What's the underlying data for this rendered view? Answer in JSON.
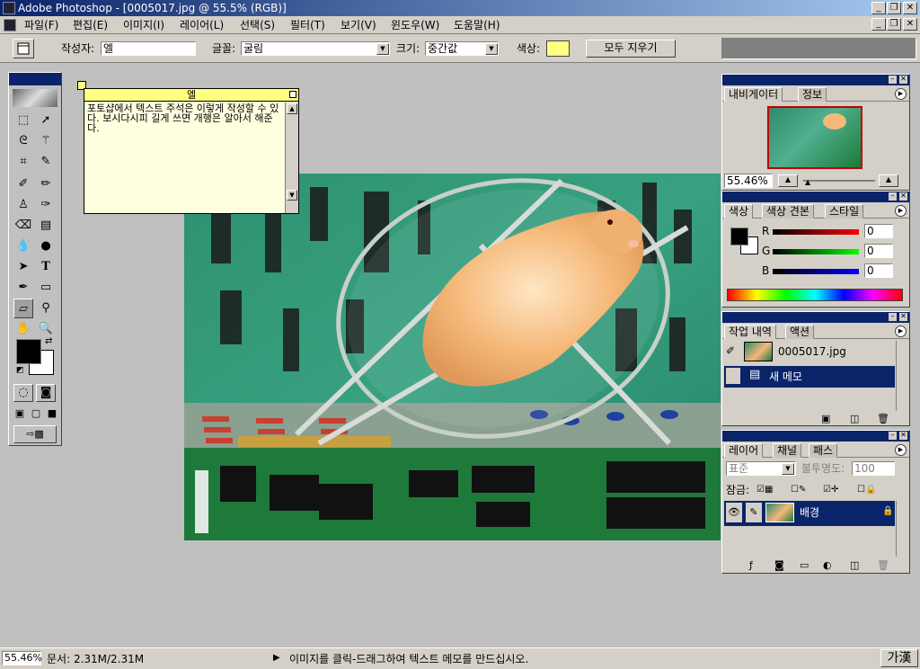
{
  "app": {
    "title": "Adobe Photoshop - [0005017.jpg @ 55.5% (RGB)]"
  },
  "menu": [
    "파일(F)",
    "편집(E)",
    "이미지(I)",
    "레이어(L)",
    "선택(S)",
    "필터(T)",
    "보기(V)",
    "윈도우(W)",
    "도움말(H)"
  ],
  "options": {
    "author_label": "작성자:",
    "author_value": "엘",
    "font_label": "글꼴:",
    "font_value": "굴림",
    "size_label": "크기:",
    "size_value": "중간값",
    "color_label": "색상:",
    "note_color": "#ffff80",
    "clear_all": "모두 지우기"
  },
  "note": {
    "title": "엘",
    "text": "포토샵에서 텍스트 주석은 이렇게 작성할 수 있다. 보시다시피 길게 쓰면 개행은 알아서 해준다."
  },
  "navigator": {
    "tabs": [
      "내비게이터",
      "정보"
    ],
    "zoom": "55.46%"
  },
  "color_panel": {
    "tabs": [
      "색상",
      "색상 견본",
      "스타일"
    ],
    "r_label": "R",
    "g_label": "G",
    "b_label": "B",
    "r": "0",
    "g": "0",
    "b": "0",
    "foreground": "#000000",
    "background": "#ffffff"
  },
  "history": {
    "tabs": [
      "작업 내역",
      "액션"
    ],
    "items": [
      "0005017.jpg",
      "새 메모"
    ]
  },
  "layers": {
    "tabs": [
      "레이어",
      "채널",
      "패스"
    ],
    "blend_mode": "표준",
    "opacity_label": "불투명도:",
    "opacity": "100",
    "lock_label": "잠금:",
    "layer_name": "배경"
  },
  "status": {
    "zoom": "55.46%",
    "doc": "문서: 2.31M/2.31M",
    "hint": "이미지를 클릭-드래그하여 텍스트 메모를 만드십시오.",
    "ime": "가漢"
  }
}
